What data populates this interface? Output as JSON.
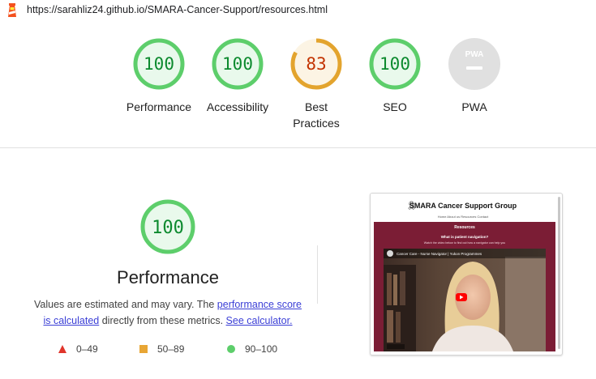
{
  "header": {
    "url": "https://sarahliz24.github.io/SMARA-Cancer-Support/resources.html"
  },
  "categories": [
    {
      "label": "Performance",
      "score": "100",
      "fraction": 1.0,
      "status": "pass"
    },
    {
      "label": "Accessibility",
      "score": "100",
      "fraction": 1.0,
      "status": "pass"
    },
    {
      "label": "Best Practices",
      "label_line1": "Best",
      "label_line2": "Practices",
      "score": "83",
      "fraction": 0.83,
      "status": "average"
    },
    {
      "label": "SEO",
      "score": "100",
      "fraction": 1.0,
      "status": "pass"
    },
    {
      "label": "PWA",
      "score": "",
      "status": "na",
      "badge_text": "PWA"
    }
  ],
  "performance": {
    "score": "100",
    "title": "Performance",
    "desc_prefix": "Values are estimated and may vary. The ",
    "desc_link1": "performance score is calculated",
    "desc_middle": " directly from these metrics. ",
    "desc_link2": "See calculator.",
    "legend": [
      {
        "range": "0–49",
        "shape": "triangle",
        "color": "#e0352b"
      },
      {
        "range": "50–89",
        "shape": "square",
        "color": "#e8a635"
      },
      {
        "range": "90–100",
        "shape": "circle",
        "color": "#5dce6b"
      }
    ]
  },
  "screenshot": {
    "site_title": "SMARA Cancer Support Group",
    "nav": "Home   About us   Resources   Contact",
    "section": "Resources",
    "question": "What is patient navigation?",
    "subtitle": "Watch the video below to find out how a navigator can help you",
    "video_caption": "Cancer Care - Nurse Navigator | Yukon Programmes"
  },
  "colors": {
    "pass": "#0c8a2e",
    "pass_ring": "#5dce6b",
    "pass_fill": "#e9f9ec",
    "average": "#c33300",
    "average_ring": "#e3a42e",
    "average_fill": "#fcf4e4",
    "na_fill": "#e0e0e0"
  }
}
